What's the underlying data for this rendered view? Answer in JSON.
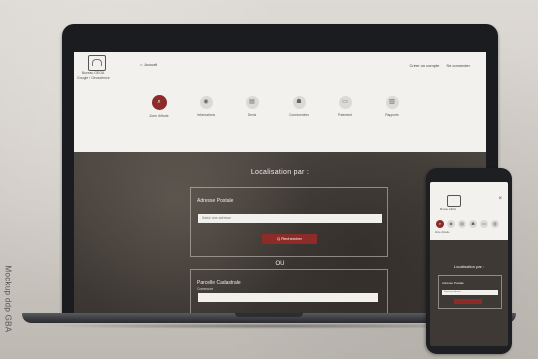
{
  "watermark": "Mockup ddp GBA",
  "laptop": {
    "brand_line1": "Bureau GEOA",
    "brand_line2": "Google / Geoscience",
    "home_link": "Accueil",
    "home_icon": "house-icon",
    "top_right": [
      "Créer un compte",
      "Se connecter"
    ],
    "nav": [
      {
        "label": "Zone d'étude",
        "icon": "search-icon",
        "glyph": "⌕",
        "active": true
      },
      {
        "label": "Informations",
        "icon": "info-icon",
        "glyph": "◉",
        "active": false
      },
      {
        "label": "Devis",
        "icon": "document-icon",
        "glyph": "▤",
        "active": false
      },
      {
        "label": "Coordonnées",
        "icon": "contact-icon",
        "glyph": "☗",
        "active": false
      },
      {
        "label": "Paiement",
        "icon": "card-icon",
        "glyph": "▭",
        "active": false
      },
      {
        "label": "Rapports",
        "icon": "report-icon",
        "glyph": "▥",
        "active": false
      }
    ],
    "section_title": "Localisation par :",
    "panel1": {
      "title": "Adresse Postale",
      "placeholder": "Saisir une adresse",
      "button": "Q Rechercher"
    },
    "or_text": "OU",
    "panel2": {
      "title": "Parcelle Cadastrale",
      "sub": "Commune"
    }
  },
  "phone": {
    "brand": "Bureau GEOA",
    "close_glyph": "×",
    "nav_glyphs": [
      "⌕",
      "◉",
      "▤",
      "☗",
      "▭",
      "▥"
    ],
    "sublabel": "Zone d'étude",
    "section_title": "Localisation par :",
    "panel_title": "Adresse Postale",
    "placeholder": "Saisir une adresse"
  },
  "colors": {
    "accent": "#8c2b27",
    "header_bg": "#f3f1ee"
  }
}
